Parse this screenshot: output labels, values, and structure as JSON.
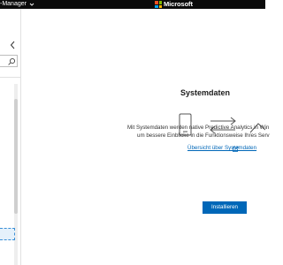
{
  "window": {
    "app_title": "-Manager",
    "brand": "Microsoft",
    "brand_colors": [
      "#f25022",
      "#7fba00",
      "#00a4ef",
      "#ffb900"
    ]
  },
  "sidebar": {
    "collapse_icon": "chevron-left-icon",
    "search_icon": "search-icon",
    "selected_item_label": ""
  },
  "main": {
    "title": "Systemdaten",
    "icons": [
      "phone-device-icon",
      "sync-arrows-icon",
      "trend-line-icon"
    ],
    "description_line1": "Mit Systemdaten werden native Predictive Analytics in Win",
    "description_line2": "um bessere Einblicke in die Funktionsweise Ihres Serv",
    "link_label": "Übersicht über Systemdaten",
    "install_button_label": "Installieren",
    "accent_color": "#0067b8"
  }
}
